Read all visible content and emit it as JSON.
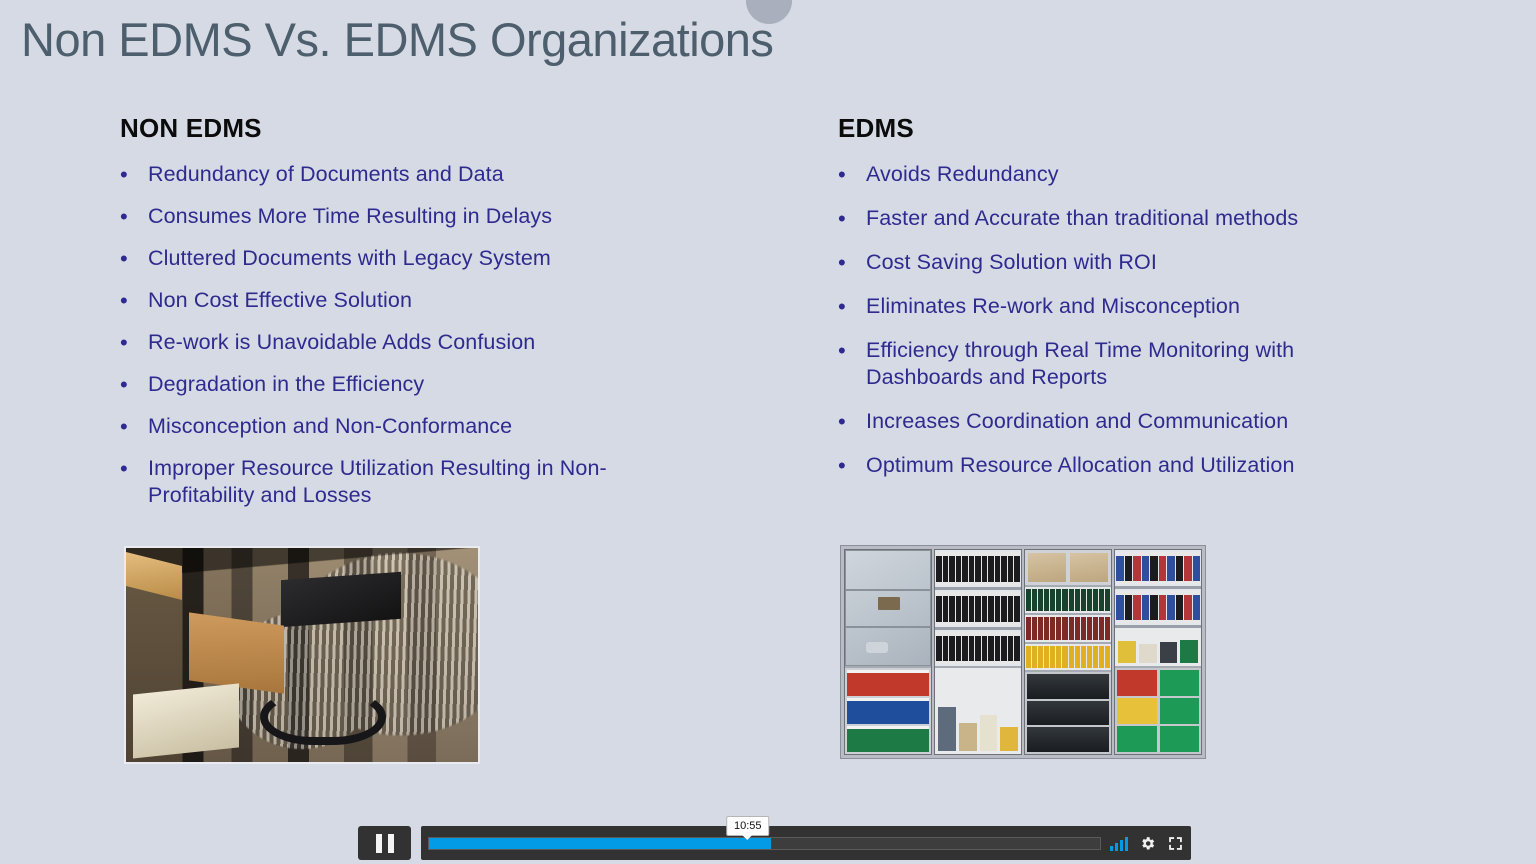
{
  "slide": {
    "title": "Non EDMS Vs. EDMS Organizations",
    "background_color": "#d6dae4",
    "title_color": "#4d5e6d",
    "bullet_text_color": "#2f2a8f",
    "heading_color": "#0b0b0b"
  },
  "columns": {
    "left": {
      "heading": "NON EDMS",
      "bullet_glyph": "•",
      "items": [
        "Redundancy of Documents and Data",
        "Consumes More Time Resulting in Delays",
        "Cluttered Documents with Legacy System",
        "Non Cost Effective Solution",
        "Re-work is Unavoidable Adds Confusion",
        "Degradation in the Efficiency",
        "Misconception and Non-Conformance",
        "Improper Resource Utilization Resulting in Non-Profitability and Losses"
      ],
      "image_caption": "cluttered-documents-storage-photo"
    },
    "right": {
      "heading": "EDMS",
      "bullet_glyph": "•",
      "items": [
        "Avoids Redundancy",
        "Faster  and Accurate than traditional methods",
        "Cost Saving Solution with ROI",
        "Eliminates Re-work  and Misconception",
        "Efficiency through Real Time Monitoring with Dashboards and Reports",
        "Increases Coordination and Communication",
        "Optimum  Resource Allocation and Utilization"
      ],
      "image_caption": "organized-filing-shelving-photo"
    }
  },
  "player": {
    "state": "playing",
    "pause_label": "Pause",
    "time_tooltip": "10:55",
    "progress_percent": 51,
    "progress_color": "#039be5",
    "quality_label": "Quality",
    "settings_label": "Settings",
    "fullscreen_label": "Fullscreen"
  }
}
